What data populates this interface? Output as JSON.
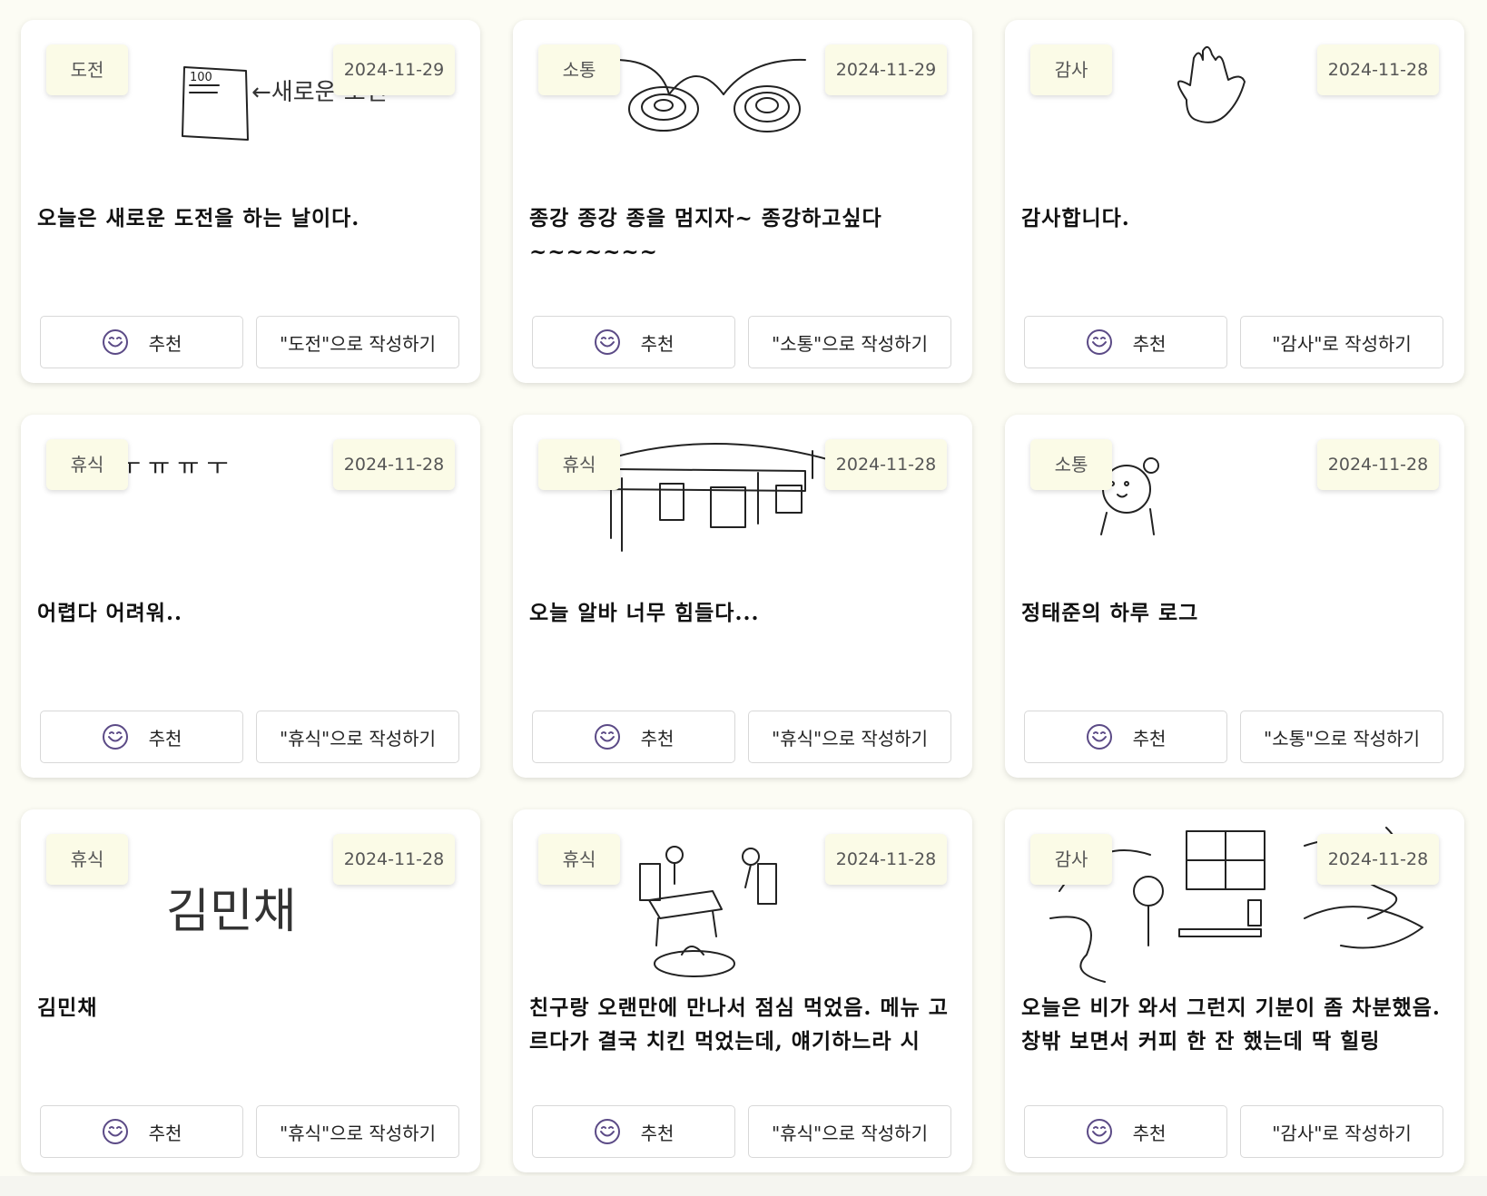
{
  "cards": [
    {
      "tag": "도전",
      "date": "2024-11-29",
      "text": "오늘은 새로운 도전을 하는 날이다.",
      "recommend": "추천",
      "write": "\"도전\"으로 작성하기",
      "drawing_text": "←새로운 도전"
    },
    {
      "tag": "소통",
      "date": "2024-11-29",
      "text": "종강 종강 종을 멈지자~ 종강하고싶다~~~~~~~",
      "recommend": "추천",
      "write": "\"소통\"으로 작성하기"
    },
    {
      "tag": "감사",
      "date": "2024-11-28",
      "text": "감사합니다.",
      "recommend": "추천",
      "write": "\"감사\"로 작성하기"
    },
    {
      "tag": "휴식",
      "date": "2024-11-28",
      "text": "어렵다 어려워..",
      "recommend": "추천",
      "write": "\"휴식\"으로 작성하기",
      "drawing_text": "ㅜ ㅠ ㅠ ㅜ"
    },
    {
      "tag": "휴식",
      "date": "2024-11-28",
      "text": "오늘 알바 너무 힘들다...",
      "recommend": "추천",
      "write": "\"휴식\"으로 작성하기"
    },
    {
      "tag": "소통",
      "date": "2024-11-28",
      "text": "정태준의 하루 로그",
      "recommend": "추천",
      "write": "\"소통\"으로 작성하기"
    },
    {
      "tag": "휴식",
      "date": "2024-11-28",
      "text": "김민채",
      "recommend": "추천",
      "write": "\"휴식\"으로 작성하기",
      "drawing_text": "김민채"
    },
    {
      "tag": "휴식",
      "date": "2024-11-28",
      "text": "친구랑 오랜만에 만나서 점심 먹었음. 메뉴 고르다가 결국 치킨 먹었는데, 얘기하느라 시",
      "recommend": "추천",
      "write": "\"휴식\"으로 작성하기"
    },
    {
      "tag": "감사",
      "date": "2024-11-28",
      "text": "오늘은 비가 와서 그런지 기분이 좀 차분했음. 창밖 보면서 커피 한 잔 했는데 딱 힐링",
      "recommend": "추천",
      "write": "\"감사\"로 작성하기"
    }
  ],
  "icons": {
    "recommend": "smile-emoji-icon"
  },
  "colors": {
    "badge_bg": "#fbfbe7",
    "page_bg": "#fcfcf4",
    "smile_stroke": "#5b4a86"
  }
}
